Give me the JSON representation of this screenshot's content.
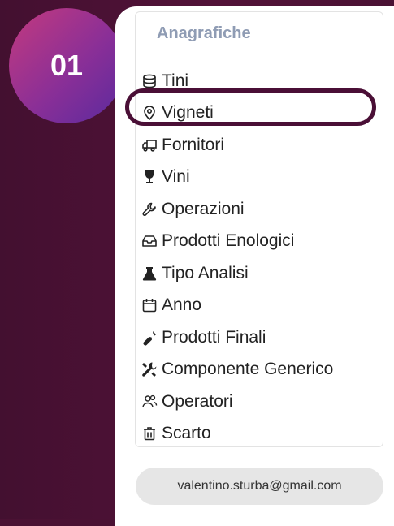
{
  "step": {
    "number": "01"
  },
  "sidebar": {
    "section_title": "Anagrafiche",
    "items": [
      {
        "label": "Tini",
        "icon": "database-icon"
      },
      {
        "label": "Vigneti",
        "icon": "map-pin-icon",
        "highlighted": true
      },
      {
        "label": "Fornitori",
        "icon": "truck-icon"
      },
      {
        "label": "Vini",
        "icon": "wine-glass-icon"
      },
      {
        "label": "Operazioni",
        "icon": "wrench-icon"
      },
      {
        "label": "Prodotti Enologici",
        "icon": "inbox-icon"
      },
      {
        "label": "Tipo Analisi",
        "icon": "flask-icon"
      },
      {
        "label": "Anno",
        "icon": "calendar-icon"
      },
      {
        "label": "Prodotti Finali",
        "icon": "wine-bottle-icon"
      },
      {
        "label": "Componente Generico",
        "icon": "tools-icon"
      },
      {
        "label": "Operatori",
        "icon": "users-icon"
      },
      {
        "label": "Scarto",
        "icon": "trash-icon"
      }
    ]
  },
  "user": {
    "email": "valentino.sturba@gmail.com"
  },
  "colors": {
    "background": "#4a1133",
    "badge_start": "#c43a7e",
    "badge_end": "#5a2a9e",
    "section_title": "#8f9cb4",
    "highlight_border": "#4a0f36"
  }
}
